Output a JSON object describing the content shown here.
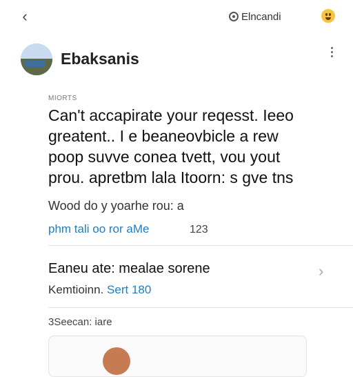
{
  "topbar": {
    "back_icon": "chevron-left-icon",
    "link_label": "Elncandi",
    "link_icon": "location-pin-icon",
    "emoji_icon": "emoji-face-icon"
  },
  "header": {
    "name": "Ebaksanis",
    "avatar": "landscape-avatar",
    "more_icon": "more-vertical-icon"
  },
  "post": {
    "caption": "MIORTS",
    "lines": [
      "Can't accapirate your reqesst. Ieeo",
      "greatent.. I e beaneovbicle a rew",
      "poop suvve conea tvett, vou yout",
      "prou. apretbm lala Itoorn: s gve tns"
    ],
    "subline": "Wood do y yoarhe rou: a",
    "action_link": "phm tali oo ror aMe",
    "action_count": "123"
  },
  "list_item": {
    "title": "Eaneu ate: mealae sorene",
    "sub_prefix": "Kemtioinn. ",
    "sub_accent": "Sert 180",
    "chevron_icon": "chevron-right-icon"
  },
  "section": {
    "label": "3Seecan: iare"
  },
  "colors": {
    "accent": "#1b7fc4",
    "emoji": "#f4c542"
  }
}
